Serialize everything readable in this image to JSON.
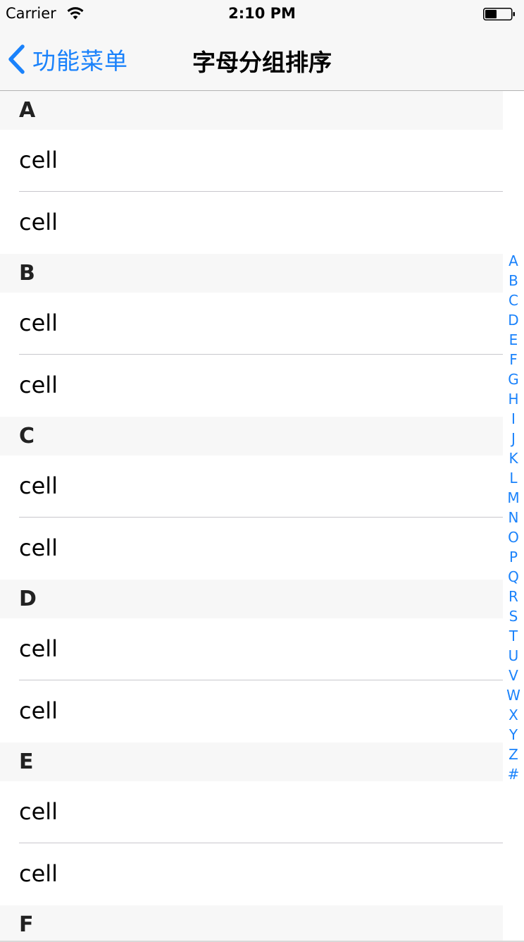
{
  "status_bar": {
    "carrier": "Carrier",
    "time": "2:10 PM",
    "icons": [
      "wifi-icon",
      "battery-icon"
    ]
  },
  "nav_bar": {
    "back_label": "功能菜单",
    "back_icon": "chevron-left-icon",
    "title": "字母分组排序",
    "accent_color": "#1a82fb"
  },
  "sections": [
    {
      "letter": "A",
      "cells": [
        "cell",
        "cell"
      ]
    },
    {
      "letter": "B",
      "cells": [
        "cell",
        "cell"
      ]
    },
    {
      "letter": "C",
      "cells": [
        "cell",
        "cell"
      ]
    },
    {
      "letter": "D",
      "cells": [
        "cell",
        "cell"
      ]
    },
    {
      "letter": "E",
      "cells": [
        "cell",
        "cell"
      ]
    },
    {
      "letter": "F",
      "cells": []
    }
  ],
  "index": [
    "A",
    "B",
    "C",
    "D",
    "E",
    "F",
    "G",
    "H",
    "I",
    "J",
    "K",
    "L",
    "M",
    "N",
    "O",
    "P",
    "Q",
    "R",
    "S",
    "T",
    "U",
    "V",
    "W",
    "X",
    "Y",
    "Z",
    "#"
  ]
}
